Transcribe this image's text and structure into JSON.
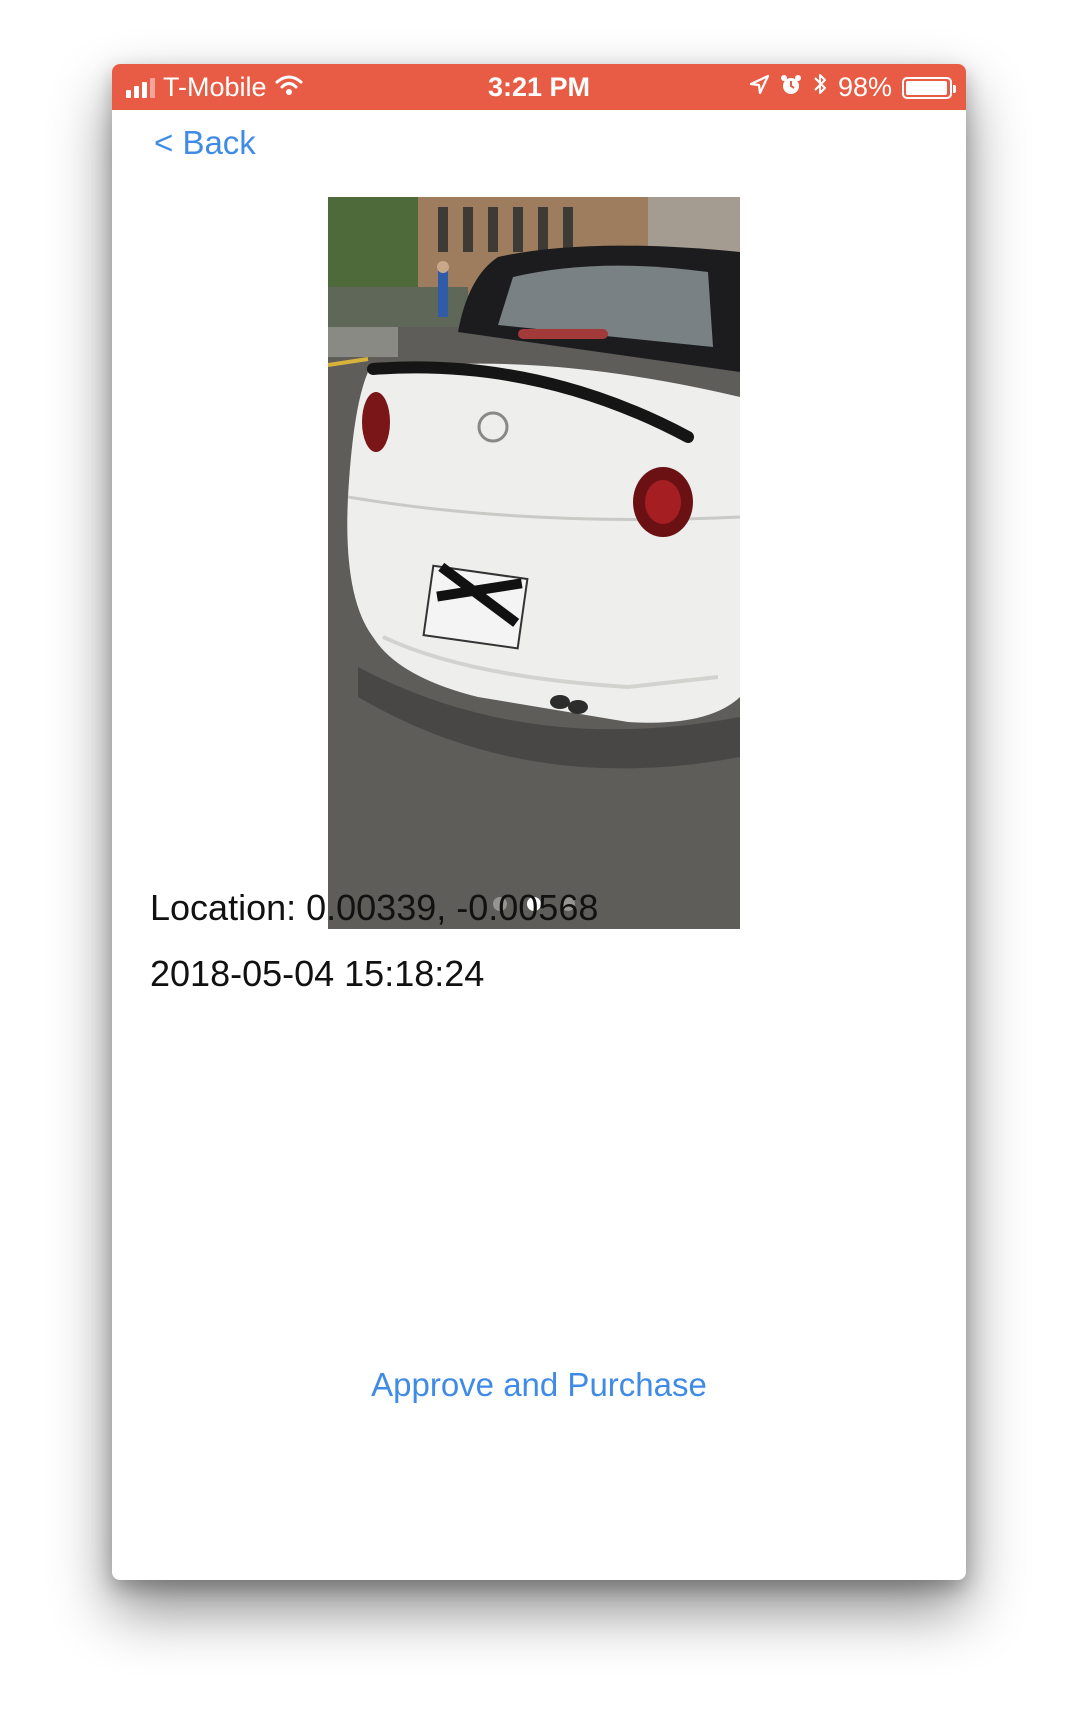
{
  "status_bar": {
    "carrier": "T-Mobile",
    "time": "3:21 PM",
    "battery": "98%",
    "battery_level": 0.98,
    "signal_bars": 3,
    "background_color": "#e85c45"
  },
  "nav": {
    "back_label": "< Back",
    "link_color": "#3f8be6"
  },
  "photo": {
    "page_count": 3,
    "current_page": 2
  },
  "details": {
    "location": "Location: 0.00339, -0.00568",
    "timestamp": "2018-05-04 15:18:24"
  },
  "actions": {
    "approve_label": "Approve and Purchase"
  },
  "icons": {
    "signal": "cellular-signal-icon",
    "wifi": "wifi-icon",
    "location": "location-arrow-icon",
    "alarm": "alarm-clock-icon",
    "bluetooth": "bluetooth-icon",
    "battery": "battery-icon"
  }
}
